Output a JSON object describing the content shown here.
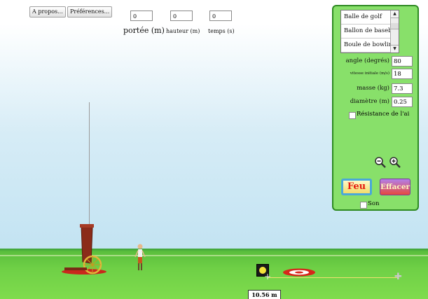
{
  "toolbar": {
    "about_label": "A propos...",
    "prefs_label": "Préférences..."
  },
  "readouts": {
    "range": {
      "value": "0",
      "label": "portée (m)"
    },
    "height": {
      "value": "0",
      "label": "hauteur (m)"
    },
    "time": {
      "value": "0",
      "label": "temps (s)"
    }
  },
  "panel": {
    "projectiles": [
      "Balle de golf",
      "Ballon de baseb",
      "Boule de bowlir"
    ],
    "angle": {
      "label": "angle (degrés)",
      "value": "80"
    },
    "speed": {
      "label": "vitesse initiale (m/s)",
      "value": "18"
    },
    "mass": {
      "label": "masse (kg)",
      "value": "7.3"
    },
    "diameter": {
      "label": "diamètre (m)",
      "value": "0.25"
    },
    "air_resistance": {
      "label": "Résistance de l'ai",
      "checked": false
    },
    "fire_label": "Feu",
    "clear_label": "Effacer",
    "sound": {
      "label": "Son",
      "checked": false
    }
  },
  "measure": {
    "distance": "10.56 m"
  },
  "colors": {
    "panel_bg": "#88e06a",
    "panel_border": "#2e8a22",
    "ground": "#6fd046",
    "target": "#d7261b",
    "cannon": "#8b2b1a"
  }
}
